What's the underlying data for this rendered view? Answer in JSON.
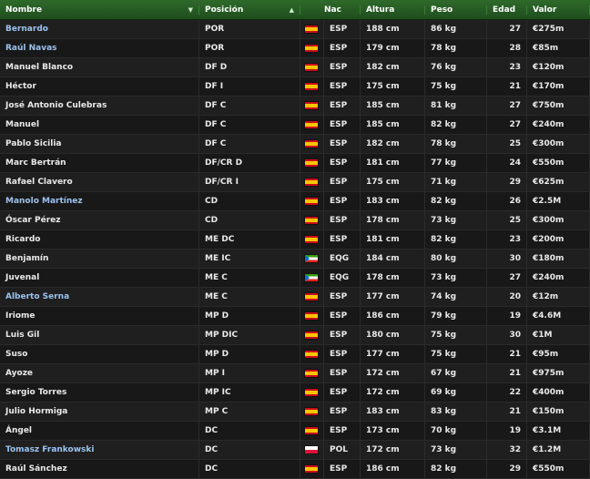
{
  "header": {
    "nombre": "Nombre",
    "posicion": "Posición",
    "nac": "Nac",
    "altura": "Altura",
    "peso": "Peso",
    "edad": "Edad",
    "valor": "Valor"
  },
  "players": [
    {
      "name": "Bernardo",
      "pos": "POR",
      "flag": "esp",
      "nac": "ESP",
      "alt": "188 cm",
      "peso": "86 kg",
      "edad": "27",
      "valor": "€275m",
      "highlight": true
    },
    {
      "name": "Raúl Navas",
      "pos": "POR",
      "flag": "esp",
      "nac": "ESP",
      "alt": "179 cm",
      "peso": "78 kg",
      "edad": "28",
      "valor": "€85m",
      "highlight": true
    },
    {
      "name": "Manuel Blanco",
      "pos": "DF D",
      "flag": "esp",
      "nac": "ESP",
      "alt": "182 cm",
      "peso": "76 kg",
      "edad": "23",
      "valor": "€120m",
      "highlight": false
    },
    {
      "name": "Héctor",
      "pos": "DF I",
      "flag": "esp",
      "nac": "ESP",
      "alt": "175 cm",
      "peso": "75 kg",
      "edad": "21",
      "valor": "€170m",
      "highlight": false
    },
    {
      "name": "José Antonio Culebras",
      "pos": "DF C",
      "flag": "esp",
      "nac": "ESP",
      "alt": "185 cm",
      "peso": "81 kg",
      "edad": "27",
      "valor": "€750m",
      "highlight": false
    },
    {
      "name": "Manuel",
      "pos": "DF C",
      "flag": "esp",
      "nac": "ESP",
      "alt": "185 cm",
      "peso": "82 kg",
      "edad": "27",
      "valor": "€240m",
      "highlight": false
    },
    {
      "name": "Pablo Sicilia",
      "pos": "DF C",
      "flag": "esp",
      "nac": "ESP",
      "alt": "182 cm",
      "peso": "78 kg",
      "edad": "25",
      "valor": "€300m",
      "highlight": false
    },
    {
      "name": "Marc Bertrán",
      "pos": "DF/CR D",
      "flag": "esp",
      "nac": "ESP",
      "alt": "181 cm",
      "peso": "77 kg",
      "edad": "24",
      "valor": "€550m",
      "highlight": false
    },
    {
      "name": "Rafael Clavero",
      "pos": "DF/CR I",
      "flag": "esp",
      "nac": "ESP",
      "alt": "175 cm",
      "peso": "71 kg",
      "edad": "29",
      "valor": "€625m",
      "highlight": false
    },
    {
      "name": "Manolo Martínez",
      "pos": "CD",
      "flag": "esp",
      "nac": "ESP",
      "alt": "183 cm",
      "peso": "82 kg",
      "edad": "26",
      "valor": "€2.5M",
      "highlight": true
    },
    {
      "name": "Óscar Pérez",
      "pos": "CD",
      "flag": "esp",
      "nac": "ESP",
      "alt": "178 cm",
      "peso": "73 kg",
      "edad": "25",
      "valor": "€300m",
      "highlight": false
    },
    {
      "name": "Ricardo",
      "pos": "ME DC",
      "flag": "esp",
      "nac": "ESP",
      "alt": "181 cm",
      "peso": "82 kg",
      "edad": "23",
      "valor": "€200m",
      "highlight": false
    },
    {
      "name": "Benjamín",
      "pos": "ME IC",
      "flag": "eqg",
      "nac": "EQG",
      "alt": "184 cm",
      "peso": "80 kg",
      "edad": "30",
      "valor": "€180m",
      "highlight": false
    },
    {
      "name": "Juvenal",
      "pos": "ME C",
      "flag": "eqg",
      "nac": "EQG",
      "alt": "178 cm",
      "peso": "73 kg",
      "edad": "27",
      "valor": "€240m",
      "highlight": false
    },
    {
      "name": "Alberto Serna",
      "pos": "ME C",
      "flag": "esp",
      "nac": "ESP",
      "alt": "177 cm",
      "peso": "74 kg",
      "edad": "20",
      "valor": "€12m",
      "highlight": true
    },
    {
      "name": "Iriome",
      "pos": "MP D",
      "flag": "esp",
      "nac": "ESP",
      "alt": "186 cm",
      "peso": "79 kg",
      "edad": "19",
      "valor": "€4.6M",
      "highlight": false
    },
    {
      "name": "Luis Gil",
      "pos": "MP DIC",
      "flag": "esp",
      "nac": "ESP",
      "alt": "180 cm",
      "peso": "75 kg",
      "edad": "30",
      "valor": "€1M",
      "highlight": false
    },
    {
      "name": "Suso",
      "pos": "MP D",
      "flag": "esp",
      "nac": "ESP",
      "alt": "177 cm",
      "peso": "75 kg",
      "edad": "21",
      "valor": "€95m",
      "highlight": false
    },
    {
      "name": "Ayoze",
      "pos": "MP I",
      "flag": "esp",
      "nac": "ESP",
      "alt": "172 cm",
      "peso": "67 kg",
      "edad": "21",
      "valor": "€975m",
      "highlight": false
    },
    {
      "name": "Sergio Torres",
      "pos": "MP IC",
      "flag": "esp",
      "nac": "ESP",
      "alt": "172 cm",
      "peso": "69 kg",
      "edad": "22",
      "valor": "€400m",
      "highlight": false
    },
    {
      "name": "Julio Hormiga",
      "pos": "MP C",
      "flag": "esp",
      "nac": "ESP",
      "alt": "183 cm",
      "peso": "83 kg",
      "edad": "21",
      "valor": "€150m",
      "highlight": false
    },
    {
      "name": "Ángel",
      "pos": "DC",
      "flag": "esp",
      "nac": "ESP",
      "alt": "173 cm",
      "peso": "70 kg",
      "edad": "19",
      "valor": "€3.1M",
      "highlight": false
    },
    {
      "name": "Tomasz Frankowski",
      "pos": "DC",
      "flag": "pol",
      "nac": "POL",
      "alt": "172 cm",
      "peso": "73 kg",
      "edad": "32",
      "valor": "€1.2M",
      "highlight": true
    },
    {
      "name": "Raúl Sánchez",
      "pos": "DC",
      "flag": "esp",
      "nac": "ESP",
      "alt": "186 cm",
      "peso": "82 kg",
      "edad": "29",
      "valor": "€550m",
      "highlight": false
    }
  ]
}
